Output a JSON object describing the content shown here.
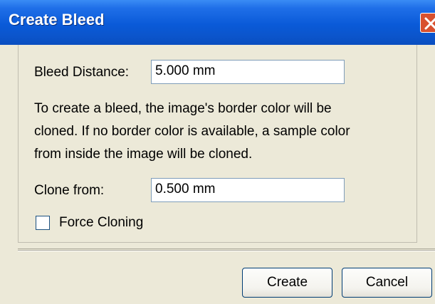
{
  "dialog": {
    "title": "Create Bleed",
    "bleed_distance": {
      "label": "Bleed Distance:",
      "value": "5.000 mm"
    },
    "description": [
      "To create a bleed, the image's border color will be",
      "cloned. If no border color is available, a sample color",
      "from inside the image will be cloned."
    ],
    "clone_from": {
      "label": "Clone from:",
      "value": "0.500 mm"
    },
    "force_cloning": {
      "label": "Force Cloning",
      "checked": false
    },
    "buttons": {
      "create": "Create",
      "cancel": "Cancel"
    },
    "colors": {
      "title_bar": "#0a5ad8",
      "face": "#ece9d8",
      "close": "#d8512f"
    },
    "icons": {
      "close": "close-icon"
    }
  }
}
